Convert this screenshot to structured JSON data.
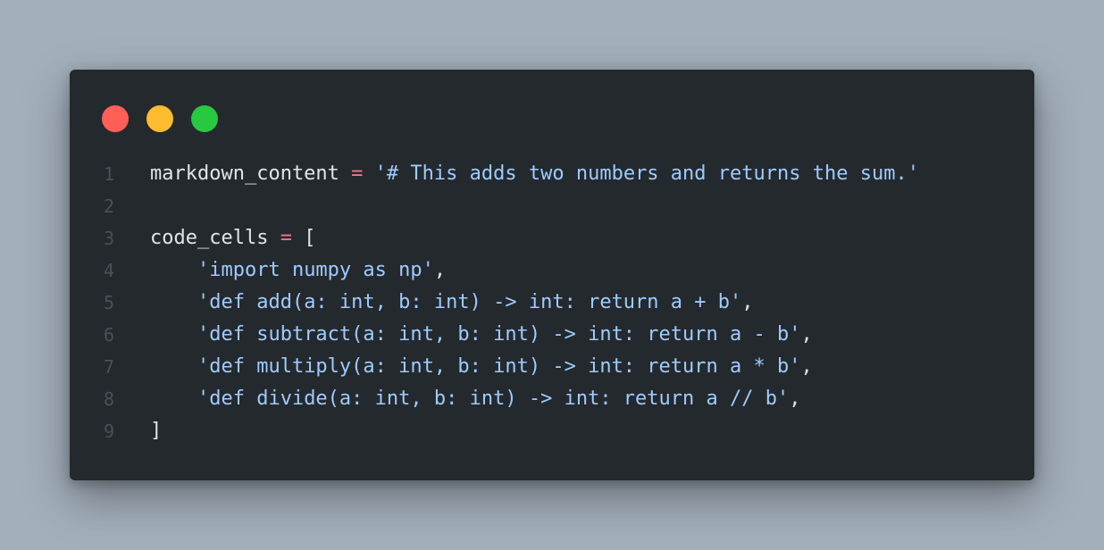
{
  "colors": {
    "background": "#a3afbb",
    "window": "#24292e",
    "dot_red": "#ff5f57",
    "dot_yellow": "#febc2e",
    "dot_green": "#28c840",
    "text": "#e1e4e8",
    "string": "#9ecbff",
    "operator": "#f97583",
    "line_number": "#4a5058"
  },
  "editor": {
    "lines": [
      {
        "number": "1",
        "tokens": [
          {
            "type": "plain",
            "text": "markdown_content "
          },
          {
            "type": "op",
            "text": "="
          },
          {
            "type": "plain",
            "text": " "
          },
          {
            "type": "str",
            "text": "'# This adds two numbers and returns the sum.'"
          }
        ]
      },
      {
        "number": "2",
        "tokens": []
      },
      {
        "number": "3",
        "tokens": [
          {
            "type": "plain",
            "text": "code_cells "
          },
          {
            "type": "op",
            "text": "="
          },
          {
            "type": "plain",
            "text": " ["
          }
        ]
      },
      {
        "number": "4",
        "tokens": [
          {
            "type": "plain",
            "text": "    "
          },
          {
            "type": "str",
            "text": "'import numpy as np'"
          },
          {
            "type": "plain",
            "text": ","
          }
        ]
      },
      {
        "number": "5",
        "tokens": [
          {
            "type": "plain",
            "text": "    "
          },
          {
            "type": "str",
            "text": "'def add(a: int, b: int) -> int: return a + b'"
          },
          {
            "type": "plain",
            "text": ","
          }
        ]
      },
      {
        "number": "6",
        "tokens": [
          {
            "type": "plain",
            "text": "    "
          },
          {
            "type": "str",
            "text": "'def subtract(a: int, b: int) -> int: return a - b'"
          },
          {
            "type": "plain",
            "text": ","
          }
        ]
      },
      {
        "number": "7",
        "tokens": [
          {
            "type": "plain",
            "text": "    "
          },
          {
            "type": "str",
            "text": "'def multiply(a: int, b: int) -> int: return a * b'"
          },
          {
            "type": "plain",
            "text": ","
          }
        ]
      },
      {
        "number": "8",
        "tokens": [
          {
            "type": "plain",
            "text": "    "
          },
          {
            "type": "str",
            "text": "'def divide(a: int, b: int) -> int: return a // b'"
          },
          {
            "type": "plain",
            "text": ","
          }
        ]
      },
      {
        "number": "9",
        "tokens": [
          {
            "type": "plain",
            "text": "]"
          }
        ]
      }
    ]
  }
}
